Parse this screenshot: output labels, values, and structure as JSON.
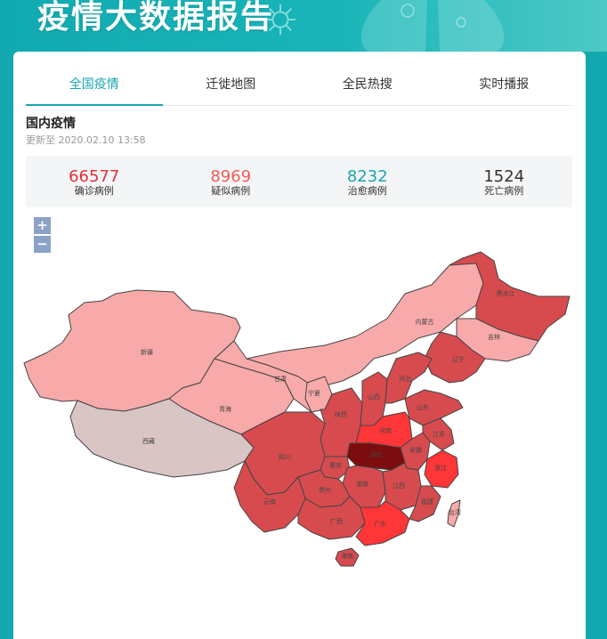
{
  "banner": {
    "title": "疫情大数据报告"
  },
  "tabs": [
    {
      "label": "全国疫情",
      "active": true
    },
    {
      "label": "迁徙地图",
      "active": false
    },
    {
      "label": "全民热搜",
      "active": false
    },
    {
      "label": "实时播报",
      "active": false
    }
  ],
  "section": {
    "title": "国内疫情",
    "updated": "更新至 2020.02.10 13:58"
  },
  "stats": [
    {
      "value": "66577",
      "label": "确诊病例",
      "color": "#e0303a"
    },
    {
      "value": "8969",
      "label": "疑似病例",
      "color": "#f25c55"
    },
    {
      "value": "8232",
      "label": "治愈病例",
      "color": "#1aa5ad"
    },
    {
      "value": "1524",
      "label": "死亡病例",
      "color": "#333333"
    }
  ],
  "zoom": {
    "in": "+",
    "out": "−"
  },
  "colors": {
    "level_lightest": "#dac5c5",
    "level_low": "#f8a9a9",
    "level_mid": "#d74b4e",
    "level_high": "#fe3637",
    "level_max": "#7d0c0e",
    "island": "#f8a9a9"
  },
  "map": {
    "provinces": [
      {
        "name": "新疆",
        "level": "low"
      },
      {
        "name": "西藏",
        "level": "lightest"
      },
      {
        "name": "青海",
        "level": "low"
      },
      {
        "name": "甘肃",
        "level": "low"
      },
      {
        "name": "内蒙古",
        "level": "low"
      },
      {
        "name": "黑龙江",
        "level": "mid"
      },
      {
        "name": "吉林",
        "level": "low"
      },
      {
        "name": "辽宁",
        "level": "mid"
      },
      {
        "name": "宁夏",
        "level": "low"
      },
      {
        "name": "陕西",
        "level": "mid"
      },
      {
        "name": "山西",
        "level": "mid"
      },
      {
        "name": "河北",
        "level": "mid"
      },
      {
        "name": "山东",
        "level": "mid"
      },
      {
        "name": "河南",
        "level": "high"
      },
      {
        "name": "四川",
        "level": "mid"
      },
      {
        "name": "重庆",
        "level": "mid"
      },
      {
        "name": "湖北",
        "level": "max"
      },
      {
        "name": "安徽",
        "level": "mid"
      },
      {
        "name": "江苏",
        "level": "mid"
      },
      {
        "name": "浙江",
        "level": "high"
      },
      {
        "name": "湖南",
        "level": "mid"
      },
      {
        "name": "江西",
        "level": "mid"
      },
      {
        "name": "贵州",
        "level": "mid"
      },
      {
        "name": "云南",
        "level": "mid"
      },
      {
        "name": "广西",
        "level": "mid"
      },
      {
        "name": "广东",
        "level": "high"
      },
      {
        "name": "福建",
        "level": "mid"
      },
      {
        "name": "海南",
        "level": "mid"
      },
      {
        "name": "台湾",
        "level": "low"
      }
    ]
  }
}
